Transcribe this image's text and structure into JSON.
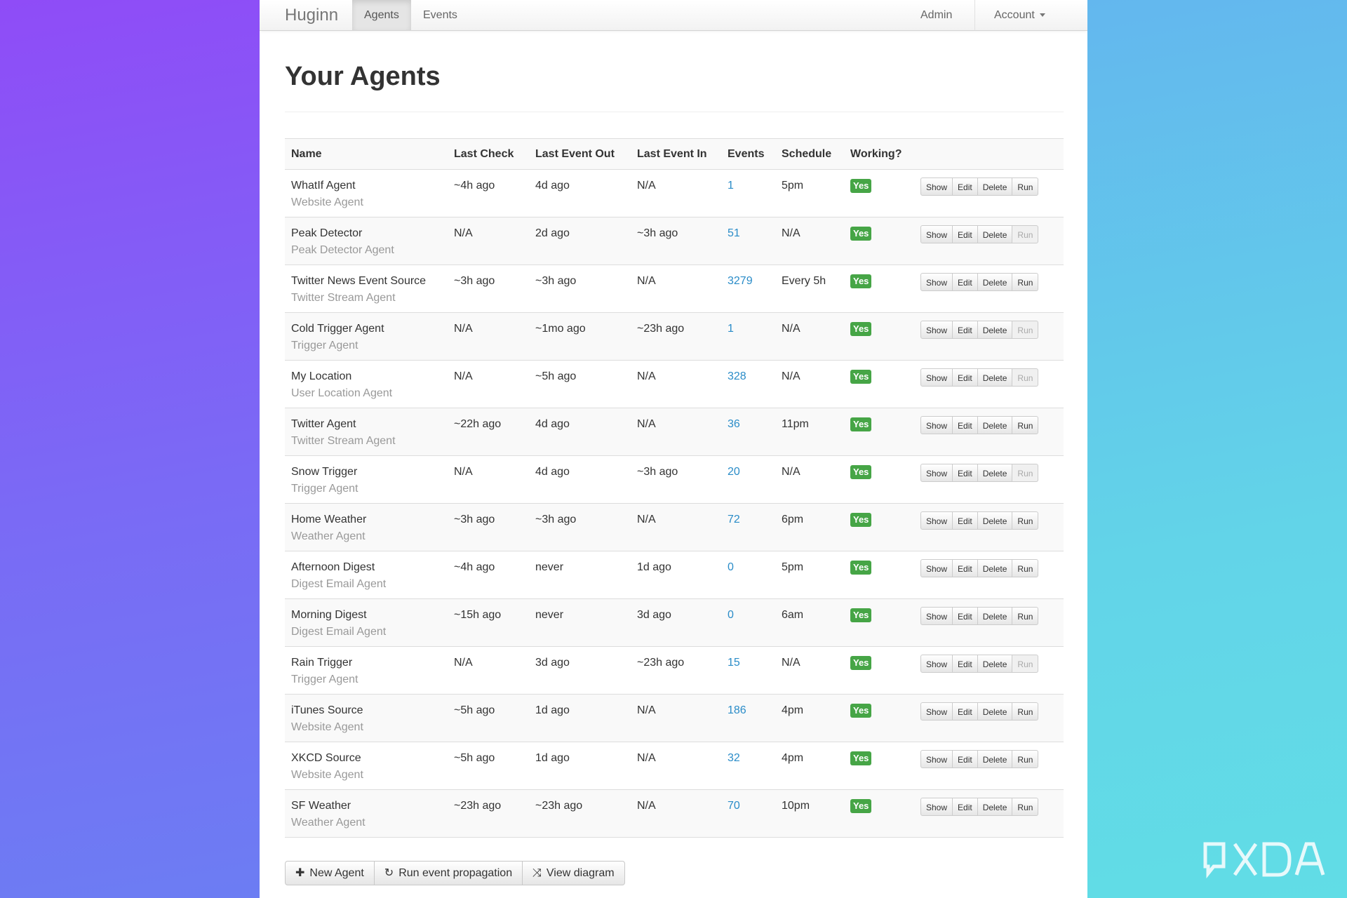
{
  "navbar": {
    "brand": "Huginn",
    "tabs": [
      {
        "label": "Agents",
        "active": true
      },
      {
        "label": "Events",
        "active": false
      }
    ],
    "admin_label": "Admin",
    "account_label": "Account"
  },
  "page": {
    "title": "Your Agents"
  },
  "table": {
    "headers": [
      "Name",
      "Last Check",
      "Last Event Out",
      "Last Event In",
      "Events",
      "Schedule",
      "Working?"
    ],
    "rows": [
      {
        "name": "WhatIf Agent",
        "type": "Website Agent",
        "last_check": "~4h ago",
        "last_event_out": "4d ago",
        "last_event_in": "N/A",
        "events": "1",
        "schedule": "5pm",
        "working": "Yes",
        "run_enabled": true
      },
      {
        "name": "Peak Detector",
        "type": "Peak Detector Agent",
        "last_check": "N/A",
        "last_event_out": "2d ago",
        "last_event_in": "~3h ago",
        "events": "51",
        "schedule": "N/A",
        "working": "Yes",
        "run_enabled": false
      },
      {
        "name": "Twitter News Event Source",
        "type": "Twitter Stream Agent",
        "last_check": "~3h ago",
        "last_event_out": "~3h ago",
        "last_event_in": "N/A",
        "events": "3279",
        "schedule": "Every 5h",
        "working": "Yes",
        "run_enabled": true
      },
      {
        "name": "Cold Trigger Agent",
        "type": "Trigger Agent",
        "last_check": "N/A",
        "last_event_out": "~1mo ago",
        "last_event_in": "~23h ago",
        "events": "1",
        "schedule": "N/A",
        "working": "Yes",
        "run_enabled": false
      },
      {
        "name": "My Location",
        "type": "User Location Agent",
        "last_check": "N/A",
        "last_event_out": "~5h ago",
        "last_event_in": "N/A",
        "events": "328",
        "schedule": "N/A",
        "working": "Yes",
        "run_enabled": false
      },
      {
        "name": "Twitter Agent",
        "type": "Twitter Stream Agent",
        "last_check": "~22h ago",
        "last_event_out": "4d ago",
        "last_event_in": "N/A",
        "events": "36",
        "schedule": "11pm",
        "working": "Yes",
        "run_enabled": true
      },
      {
        "name": "Snow Trigger",
        "type": "Trigger Agent",
        "last_check": "N/A",
        "last_event_out": "4d ago",
        "last_event_in": "~3h ago",
        "events": "20",
        "schedule": "N/A",
        "working": "Yes",
        "run_enabled": false
      },
      {
        "name": "Home Weather",
        "type": "Weather Agent",
        "last_check": "~3h ago",
        "last_event_out": "~3h ago",
        "last_event_in": "N/A",
        "events": "72",
        "schedule": "6pm",
        "working": "Yes",
        "run_enabled": true
      },
      {
        "name": "Afternoon Digest",
        "type": "Digest Email Agent",
        "last_check": "~4h ago",
        "last_event_out": "never",
        "last_event_in": "1d ago",
        "events": "0",
        "schedule": "5pm",
        "working": "Yes",
        "run_enabled": true
      },
      {
        "name": "Morning Digest",
        "type": "Digest Email Agent",
        "last_check": "~15h ago",
        "last_event_out": "never",
        "last_event_in": "3d ago",
        "events": "0",
        "schedule": "6am",
        "working": "Yes",
        "run_enabled": true
      },
      {
        "name": "Rain Trigger",
        "type": "Trigger Agent",
        "last_check": "N/A",
        "last_event_out": "3d ago",
        "last_event_in": "~23h ago",
        "events": "15",
        "schedule": "N/A",
        "working": "Yes",
        "run_enabled": false
      },
      {
        "name": "iTunes Source",
        "type": "Website Agent",
        "last_check": "~5h ago",
        "last_event_out": "1d ago",
        "last_event_in": "N/A",
        "events": "186",
        "schedule": "4pm",
        "working": "Yes",
        "run_enabled": true
      },
      {
        "name": "XKCD Source",
        "type": "Website Agent",
        "last_check": "~5h ago",
        "last_event_out": "1d ago",
        "last_event_in": "N/A",
        "events": "32",
        "schedule": "4pm",
        "working": "Yes",
        "run_enabled": true
      },
      {
        "name": "SF Weather",
        "type": "Weather Agent",
        "last_check": "~23h ago",
        "last_event_out": "~23h ago",
        "last_event_in": "N/A",
        "events": "70",
        "schedule": "10pm",
        "working": "Yes",
        "run_enabled": true
      }
    ],
    "actions": {
      "show": "Show",
      "edit": "Edit",
      "delete": "Delete",
      "run": "Run"
    }
  },
  "footer": {
    "new_agent": "New Agent",
    "run_propagation": "Run event propagation",
    "view_diagram": "View diagram"
  },
  "icons": {
    "plus": "plus-icon",
    "refresh": "refresh-icon",
    "shuffle": "shuffle-icon"
  },
  "colors": {
    "working_badge": "#46a546",
    "events_link": "#2a8cc8",
    "bg_left": "#8f4cf7",
    "bg_right": "#61dde6"
  }
}
